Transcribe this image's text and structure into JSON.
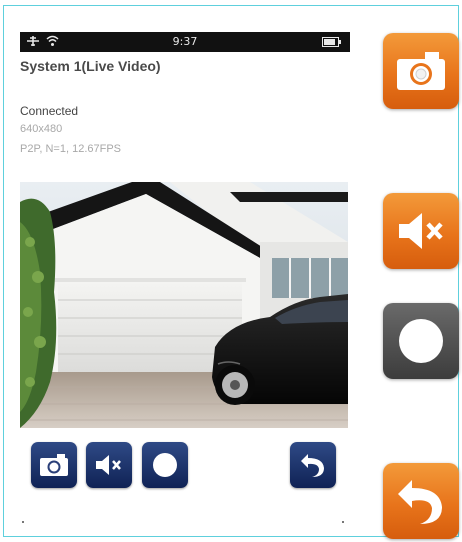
{
  "status_bar": {
    "time": "9:37"
  },
  "header": {
    "title": "System 1(Live Video)"
  },
  "connection": {
    "status": "Connected",
    "resolution": "640x480",
    "stream_info": "P2P, N=1, 12.67FPS"
  },
  "toolbar": {
    "buttons": [
      {
        "name": "snapshot-button",
        "icon": "camera-icon"
      },
      {
        "name": "mute-button",
        "icon": "speaker-mute-icon"
      },
      {
        "name": "record-button",
        "icon": "record-icon"
      },
      {
        "name": "back-button",
        "icon": "back-arrow-icon"
      }
    ]
  },
  "legend_buttons": {
    "snapshot": {
      "icon": "camera-icon",
      "color": "#e8741b"
    },
    "mute": {
      "icon": "speaker-mute-icon",
      "color": "#e8741b"
    },
    "record": {
      "icon": "record-icon",
      "color": "#4a4a4a"
    },
    "back": {
      "icon": "back-arrow-icon",
      "color": "#e8741b"
    }
  },
  "colors": {
    "frame_border": "#5ed0dd",
    "toolbar_button": "#1a2f66",
    "accent_orange": "#e8741b",
    "status_bar": "#111111"
  }
}
